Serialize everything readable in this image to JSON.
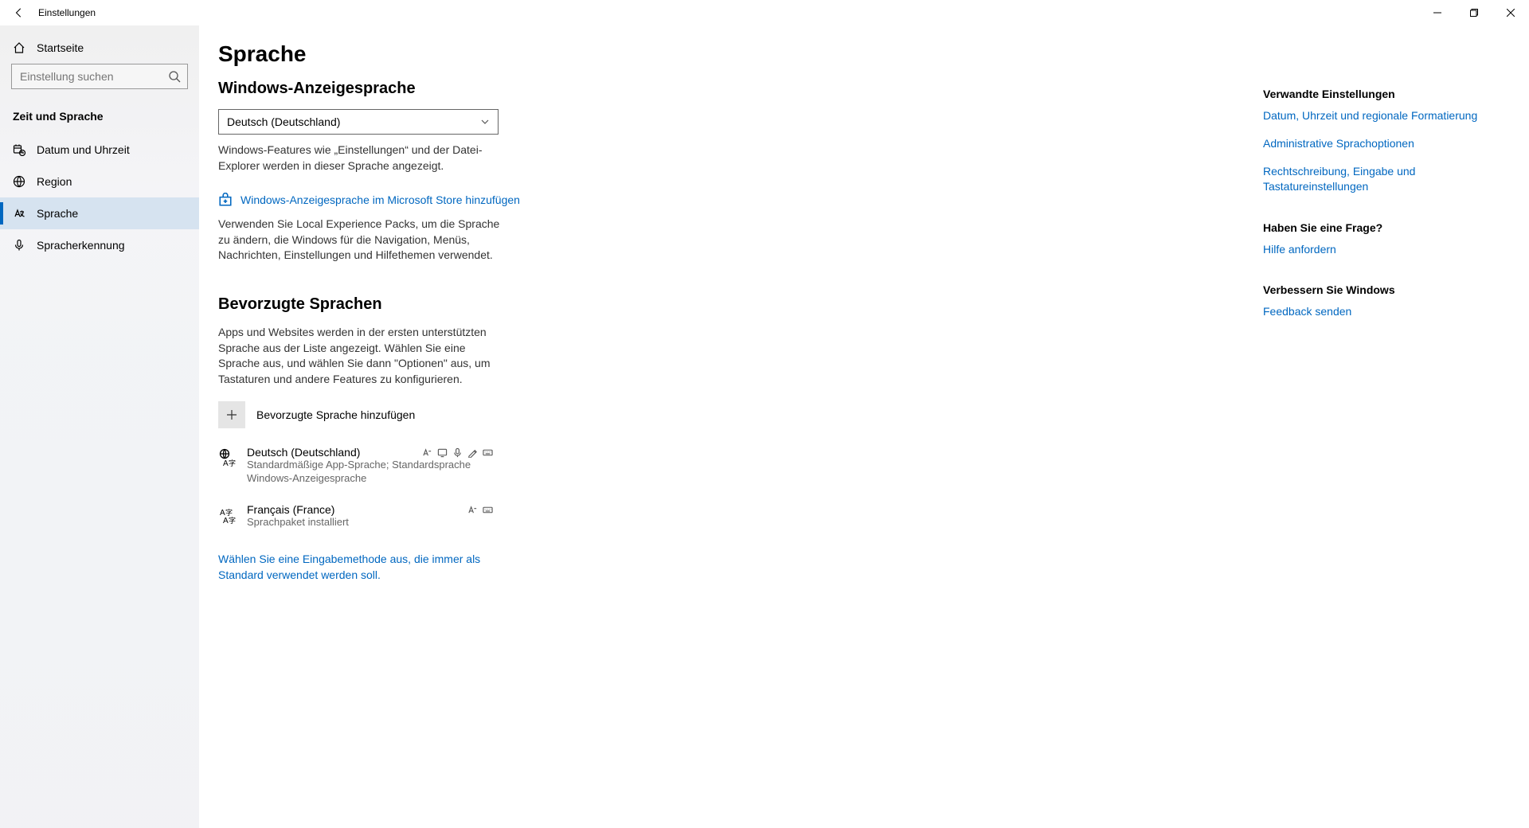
{
  "window": {
    "title": "Einstellungen"
  },
  "sidebar": {
    "home": "Startseite",
    "search_placeholder": "Einstellung suchen",
    "category": "Zeit und Sprache",
    "items": [
      {
        "label": "Datum und Uhrzeit"
      },
      {
        "label": "Region"
      },
      {
        "label": "Sprache"
      },
      {
        "label": "Spracherkennung"
      }
    ]
  },
  "page": {
    "title": "Sprache",
    "display_lang": {
      "heading": "Windows-Anzeigesprache",
      "selected": "Deutsch (Deutschland)",
      "description": "Windows-Features wie „Einstellungen“ und der Datei-Explorer werden in dieser Sprache angezeigt.",
      "store_link": "Windows-Anzeigesprache im Microsoft Store hinzufügen",
      "store_description": "Verwenden Sie Local Experience Packs, um die Sprache zu ändern, die Windows für die Navigation, Menüs, Nachrichten, Einstellungen und Hilfethemen verwendet."
    },
    "preferred": {
      "heading": "Bevorzugte Sprachen",
      "description": "Apps und Websites werden in der ersten unterstützten Sprache aus der Liste angezeigt. Wählen Sie eine Sprache aus, und wählen Sie dann \"Optionen\" aus, um Tastaturen und andere Features zu konfigurieren.",
      "add_label": "Bevorzugte Sprache hinzufügen",
      "items": [
        {
          "title": "Deutsch (Deutschland)",
          "subtitle": "Standardmäßige App-Sprache; Standardsprache Windows-Anzeigesprache"
        },
        {
          "title": "Français (France)",
          "subtitle": "Sprachpaket installiert"
        }
      ],
      "method_link": "Wählen Sie eine Eingabemethode aus, die immer als Standard verwendet werden soll."
    }
  },
  "right": {
    "related_heading": "Verwandte Einstellungen",
    "related_links": [
      "Datum, Uhrzeit und regionale Formatierung",
      "Administrative Sprachoptionen",
      "Rechtschreibung, Eingabe und Tastatureinstellungen"
    ],
    "question_heading": "Haben Sie eine Frage?",
    "help_link": "Hilfe anfordern",
    "improve_heading": "Verbessern Sie Windows",
    "feedback_link": "Feedback senden"
  }
}
